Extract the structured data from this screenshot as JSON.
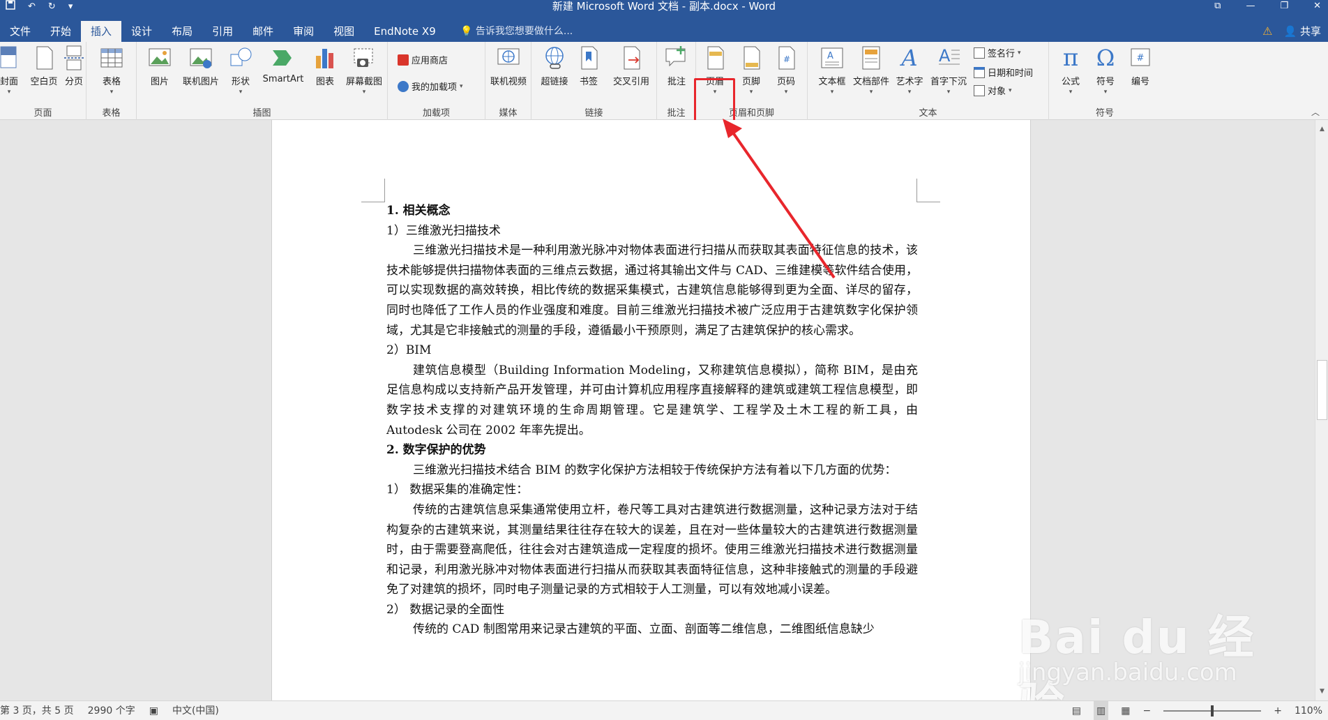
{
  "window": {
    "title": "新建 Microsoft Word 文档 - 副本.docx - Word",
    "share_label": "共享"
  },
  "tabs": [
    {
      "label": "文件"
    },
    {
      "label": "开始"
    },
    {
      "label": "插入"
    },
    {
      "label": "设计"
    },
    {
      "label": "布局"
    },
    {
      "label": "引用"
    },
    {
      "label": "邮件"
    },
    {
      "label": "审阅"
    },
    {
      "label": "视图"
    },
    {
      "label": "EndNote X9"
    }
  ],
  "tell_me": "告诉我您想要做什么...",
  "ribbon": {
    "pages": {
      "label": "页面",
      "cover": "封面",
      "blank": "空白页",
      "break": "分页"
    },
    "table": {
      "label": "表格",
      "table": "表格"
    },
    "illustrations": {
      "label": "插图",
      "picture": "图片",
      "online_picture": "联机图片",
      "shapes": "形状",
      "smartart": "SmartArt",
      "chart": "图表",
      "screenshot": "屏幕截图"
    },
    "addins": {
      "label": "加载项",
      "store": "应用商店",
      "my_addins": "我的加载项"
    },
    "media": {
      "label": "媒体",
      "online_video": "联机视频"
    },
    "links": {
      "label": "链接",
      "hyperlink": "超链接",
      "bookmark": "书签",
      "cross_ref": "交叉引用"
    },
    "comments": {
      "label": "批注",
      "comment": "批注"
    },
    "header_footer": {
      "label": "页眉和页脚",
      "header": "页眉",
      "footer": "页脚",
      "page_number": "页码"
    },
    "text": {
      "label": "文本",
      "textbox": "文本框",
      "quick_parts": "文档部件",
      "wordart": "艺术字",
      "dropcap": "首字下沉",
      "signature": "签名行",
      "datetime": "日期和时间",
      "object": "对象"
    },
    "symbols": {
      "label": "符号",
      "equation": "公式",
      "symbol": "符号",
      "number": "编号"
    }
  },
  "document": {
    "paragraphs": [
      {
        "style": "h",
        "text": "1. 相关概念"
      },
      {
        "style": "n",
        "text": "1）三维激光扫描技术"
      },
      {
        "style": "ind",
        "text": "三维激光扫描技术是一种利用激光脉冲对物体表面进行扫描从而获取其表面特征信息的技术，该技术能够提供扫描物体表面的三维点云数据，通过将其输出文件与 CAD、三维建模等软件结合使用，可以实现数据的高效转换，相比传统的数据采集模式，古建筑信息能够得到更为全面、详尽的留存，同时也降低了工作人员的作业强度和难度。目前三维激光扫描技术被广泛应用于古建筑数字化保护领域，尤其是它非接触式的测量的手段，遵循最小干预原则，满足了古建筑保护的核心需求。"
      },
      {
        "style": "n",
        "text": "2）BIM"
      },
      {
        "style": "ind",
        "text": "建筑信息模型（Building Information Modeling，又称建筑信息模拟），简称 BIM，是由充足信息构成以支持新产品开发管理，并可由计算机应用程序直接解释的建筑或建筑工程信息模型，即数字技术支撑的对建筑环境的生命周期管理。它是建筑学、工程学及土木工程的新工具，由 Autodesk 公司在 2002 年率先提出。"
      },
      {
        "style": "h",
        "text": "2. 数字保护的优势"
      },
      {
        "style": "ind",
        "text": "三维激光扫描技术结合 BIM 的数字化保护方法相较于传统保护方法有着以下几方面的优势："
      },
      {
        "style": "n",
        "text": "1） 数据采集的准确定性："
      },
      {
        "style": "ind",
        "text": "传统的古建筑信息采集通常使用立杆，卷尺等工具对古建筑进行数据测量，这种记录方法对于结构复杂的古建筑来说，其测量结果往往存在较大的误差，且在对一些体量较大的古建筑进行数据测量时，由于需要登高爬低，往往会对古建筑造成一定程度的损坏。使用三维激光扫描技术进行数据测量和记录，利用激光脉冲对物体表面进行扫描从而获取其表面特征信息，这种非接触式的测量的手段避免了对建筑的损坏，同时电子测量记录的方式相较于人工测量，可以有效地减小误差。"
      },
      {
        "style": "n",
        "text": "2） 数据记录的全面性"
      },
      {
        "style": "ind",
        "text": "传统的 CAD 制图常用来记录古建筑的平面、立面、剖面等二维信息，二维图纸信息缺少"
      }
    ]
  },
  "status": {
    "page": "第 3 页，共 5 页",
    "words": "2990 个字",
    "language": "中文(中国)",
    "zoom_minus": "−",
    "zoom_plus": "+",
    "zoom": "110%",
    "zoom_level_percent": 110
  },
  "watermark": {
    "brand": "Bai du 经验",
    "url": "jingyan.baidu.com"
  },
  "colors": {
    "titlebar": "#2b579a",
    "ribbon": "#f3f3f3",
    "highlight": "#e8262c"
  }
}
